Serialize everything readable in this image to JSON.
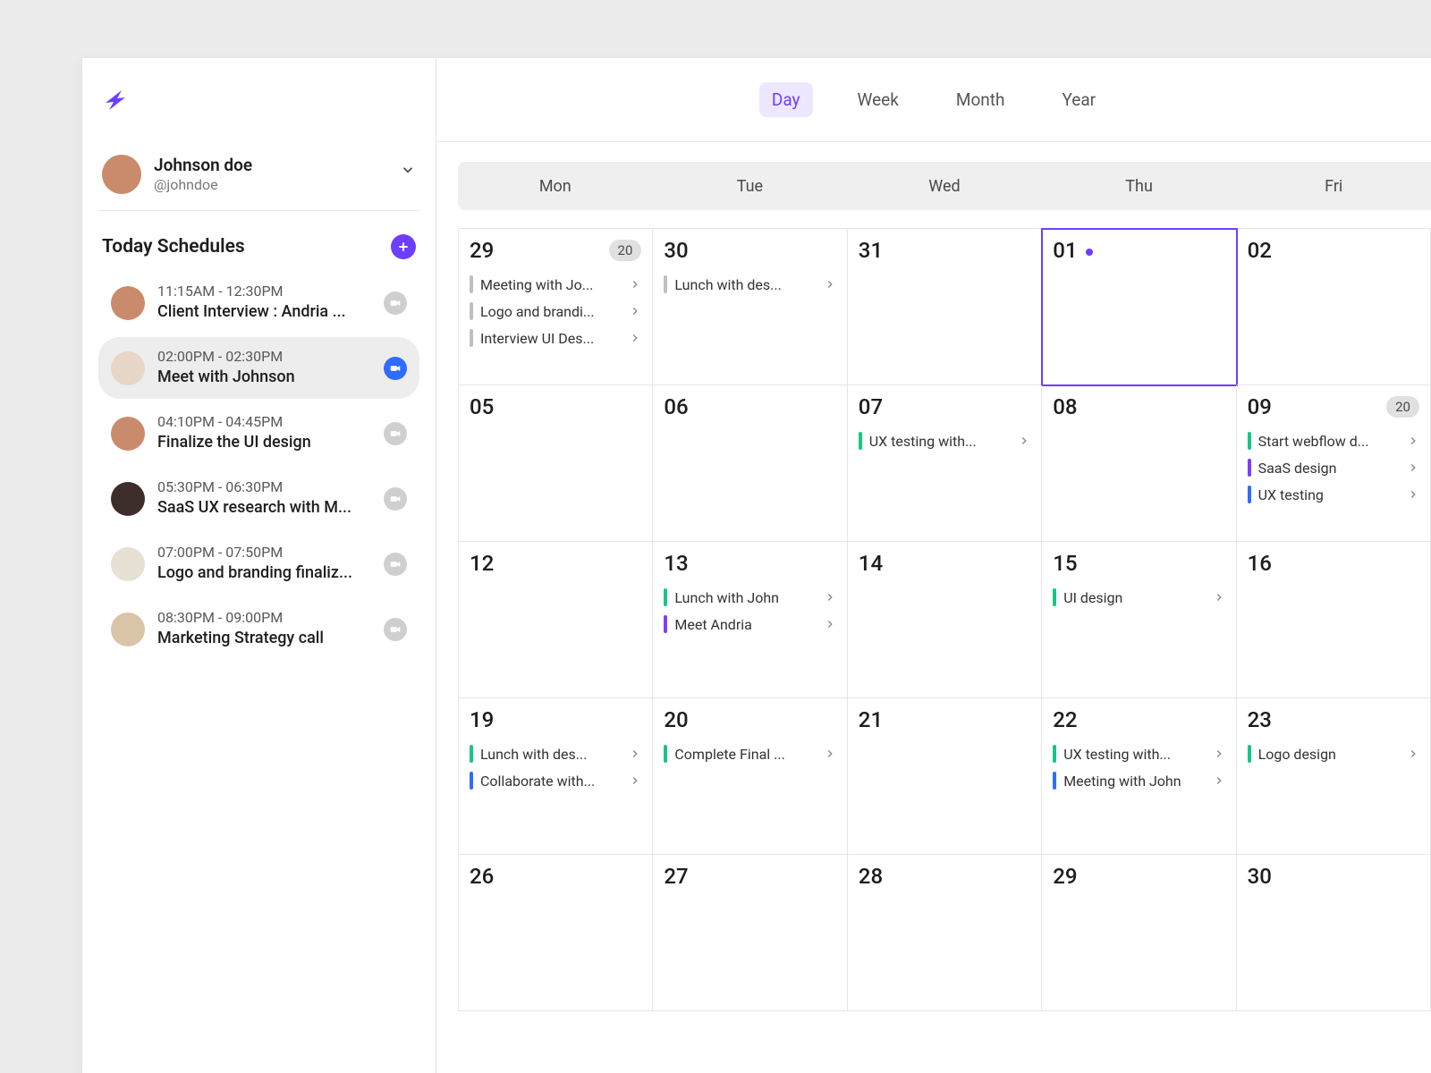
{
  "nav": {
    "tabs": [
      "Day",
      "Week",
      "Month",
      "Year"
    ],
    "active": "Day"
  },
  "profile": {
    "name": "Johnson doe",
    "handle": "@johndoe",
    "avatar_bg": "#C98B6B"
  },
  "today": {
    "heading": "Today Schedules",
    "items": [
      {
        "time": "11:15AM - 12:30PM",
        "title": "Client Interview : Andria  ...",
        "avatar_bg": "#C98B6B",
        "video": "off"
      },
      {
        "time": "02:00PM - 02:30PM",
        "title": "Meet with Johnson",
        "avatar_bg": "#E8D6C7",
        "video": "on",
        "selected": true
      },
      {
        "time": "04:10PM - 04:45PM",
        "title": "Finalize the UI design",
        "avatar_bg": "#C98B6B",
        "video": "off"
      },
      {
        "time": "05:30PM - 06:30PM",
        "title": "SaaS UX research with M...",
        "avatar_bg": "#3E2E2A",
        "video": "off"
      },
      {
        "time": "07:00PM - 07:50PM",
        "title": "Logo and branding finaliz...",
        "avatar_bg": "#E6E0D5",
        "video": "off"
      },
      {
        "time": "08:30PM - 09:00PM",
        "title": "Marketing Strategy call",
        "avatar_bg": "#D9C4A8",
        "video": "off"
      }
    ]
  },
  "calendar": {
    "weekdays": [
      "Mon",
      "Tue",
      "Wed",
      "Thu",
      "Fri"
    ],
    "rows": [
      [
        {
          "num": "29",
          "out": true,
          "badge": "20",
          "events": [
            {
              "label": "Meeting with Jo...",
              "color": "gray"
            },
            {
              "label": "Logo and brandi...",
              "color": "gray"
            },
            {
              "label": "Interview UI Des...",
              "color": "gray"
            }
          ]
        },
        {
          "num": "30",
          "out": true,
          "events": [
            {
              "label": "Lunch with des...",
              "color": "gray"
            }
          ]
        },
        {
          "num": "31",
          "out": true,
          "events": []
        },
        {
          "num": "01",
          "today": true,
          "dot": true,
          "events": []
        },
        {
          "num": "02",
          "events": []
        }
      ],
      [
        {
          "num": "05",
          "events": []
        },
        {
          "num": "06",
          "events": []
        },
        {
          "num": "07",
          "events": [
            {
              "label": "UX testing  with...",
              "color": "green"
            }
          ]
        },
        {
          "num": "08",
          "events": []
        },
        {
          "num": "09",
          "badge": "20",
          "events": [
            {
              "label": "Start webflow d...",
              "color": "green"
            },
            {
              "label": "SaaS design",
              "color": "violet"
            },
            {
              "label": "UX testing",
              "color": "blue"
            }
          ]
        }
      ],
      [
        {
          "num": "12",
          "events": []
        },
        {
          "num": "13",
          "events": [
            {
              "label": "Lunch with John",
              "color": "green"
            },
            {
              "label": "Meet Andria",
              "color": "violet"
            }
          ]
        },
        {
          "num": "14",
          "events": []
        },
        {
          "num": "15",
          "events": [
            {
              "label": "UI design",
              "color": "green"
            }
          ]
        },
        {
          "num": "16",
          "events": []
        }
      ],
      [
        {
          "num": "19",
          "events": [
            {
              "label": "Lunch with des...",
              "color": "green"
            },
            {
              "label": "Collaborate with...",
              "color": "blue"
            }
          ]
        },
        {
          "num": "20",
          "events": [
            {
              "label": "Complete Final ...",
              "color": "green"
            }
          ]
        },
        {
          "num": "21",
          "events": []
        },
        {
          "num": "22",
          "events": [
            {
              "label": "UX testing  with...",
              "color": "green"
            },
            {
              "label": "Meeting with John",
              "color": "blue"
            }
          ]
        },
        {
          "num": "23",
          "events": [
            {
              "label": "Logo design",
              "color": "green"
            }
          ]
        }
      ],
      [
        {
          "num": "26",
          "events": []
        },
        {
          "num": "27",
          "events": []
        },
        {
          "num": "28",
          "events": []
        },
        {
          "num": "29",
          "events": []
        },
        {
          "num": "30",
          "events": []
        }
      ]
    ]
  }
}
